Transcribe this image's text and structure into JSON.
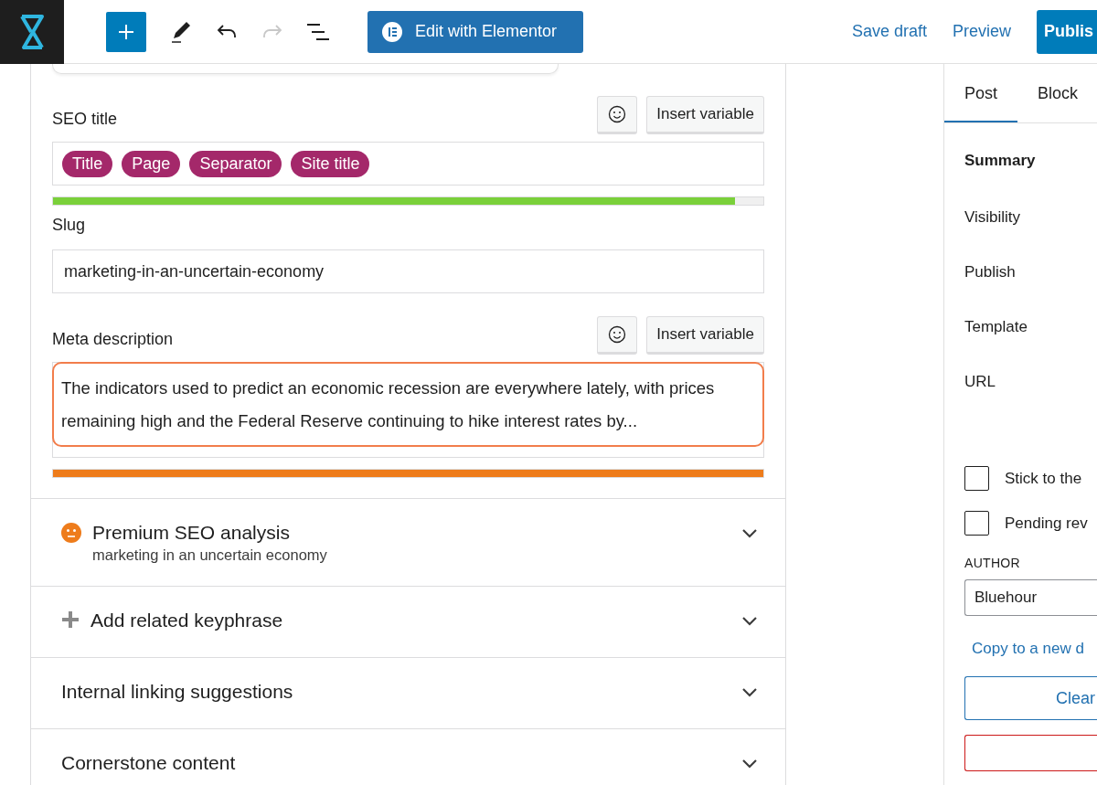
{
  "toolbar": {
    "elementor_button": "Edit with Elementor",
    "redo_disabled": true,
    "save_draft": "Save draft",
    "preview": "Preview",
    "publish": "Publis"
  },
  "seo_title": {
    "label": "SEO title",
    "insert_variable": "Insert variable",
    "tags": [
      "Title",
      "Page",
      "Separator",
      "Site title"
    ],
    "progress": {
      "level": 0.96,
      "color": "#7ad03a"
    }
  },
  "slug": {
    "label": "Slug",
    "value": "marketing-in-an-uncertain-economy"
  },
  "meta_description": {
    "label": "Meta description",
    "insert_variable": "Insert variable",
    "value": "The indicators used to predict an economic recession are everywhere lately, with prices remaining high and the Federal Reserve continuing to hike interest rates by...",
    "focused": true,
    "progress": {
      "level": 1,
      "color": "#ee7c1b"
    }
  },
  "sections": [
    {
      "kind": "analysis",
      "title": "Premium SEO analysis",
      "subtitle": "marketing in an uncertain economy",
      "expanded": false
    },
    {
      "kind": "add",
      "title": "Add related keyphrase",
      "expanded": false
    },
    {
      "kind": "plain",
      "title": "Internal linking suggestions",
      "expanded": false
    },
    {
      "kind": "plain",
      "title": "Cornerstone content",
      "expanded": false
    }
  ],
  "sidebar": {
    "tabs": [
      {
        "label": "Post",
        "selected": true
      },
      {
        "label": "Block",
        "selected": false
      }
    ],
    "summary": "Summary",
    "rows": [
      "Visibility",
      "Publish",
      "Template",
      "URL"
    ],
    "checkboxes": [
      {
        "label": "Stick to the",
        "checked": false
      },
      {
        "label": "Pending rev",
        "checked": false
      }
    ],
    "author_label": "AUTHOR",
    "author": "Bluehour",
    "copy_link": "Copy to a new d",
    "clear_button": "Clear"
  }
}
